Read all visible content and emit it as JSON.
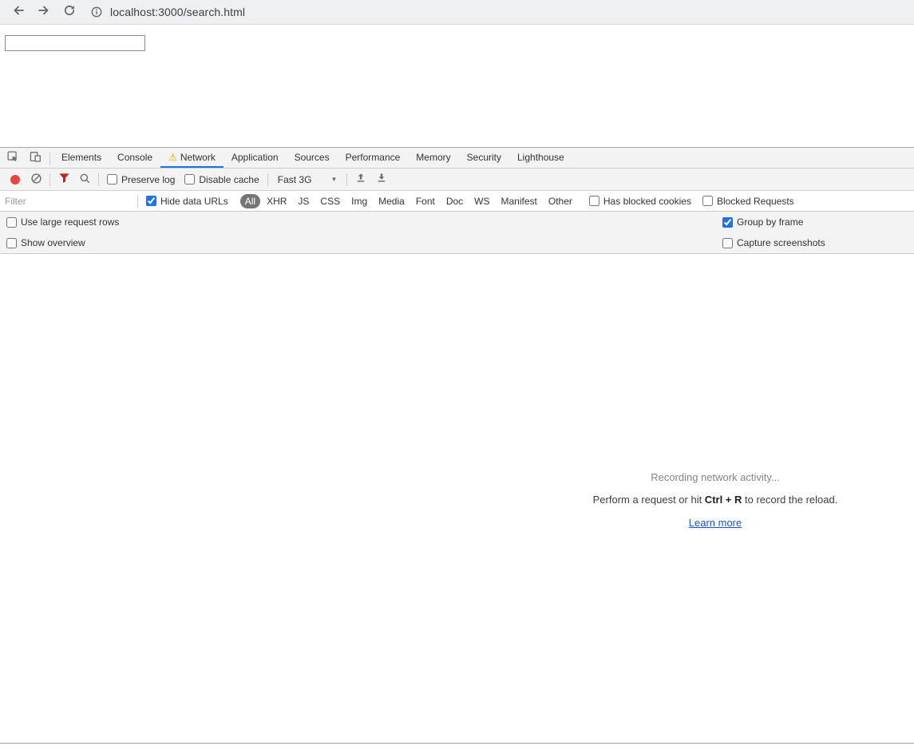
{
  "browser": {
    "url": "localhost:3000/search.html"
  },
  "page": {
    "search_value": ""
  },
  "devtools": {
    "tabs": [
      "Elements",
      "Console",
      "Network",
      "Application",
      "Sources",
      "Performance",
      "Memory",
      "Security",
      "Lighthouse"
    ],
    "active_tab": "Network",
    "toolbar": {
      "preserve_log_label": "Preserve log",
      "preserve_log_checked": false,
      "disable_cache_label": "Disable cache",
      "disable_cache_checked": false,
      "throttling_value": "Fast 3G"
    },
    "filter_bar": {
      "filter_placeholder": "Filter",
      "hide_data_urls_label": "Hide data URLs",
      "hide_data_urls_checked": true,
      "type_filters": [
        "All",
        "XHR",
        "JS",
        "CSS",
        "Img",
        "Media",
        "Font",
        "Doc",
        "WS",
        "Manifest",
        "Other"
      ],
      "selected_type": "All",
      "has_blocked_cookies_label": "Has blocked cookies",
      "has_blocked_cookies_checked": false,
      "blocked_requests_label": "Blocked Requests",
      "blocked_requests_checked": false
    },
    "options": {
      "use_large_request_rows_label": "Use large request rows",
      "use_large_request_rows_checked": false,
      "group_by_frame_label": "Group by frame",
      "group_by_frame_checked": true,
      "show_overview_label": "Show overview",
      "show_overview_checked": false,
      "capture_screenshots_label": "Capture screenshots",
      "capture_screenshots_checked": false
    },
    "empty_state": {
      "title": "Recording network activity...",
      "hint_prefix": "Perform a request or hit ",
      "hint_shortcut": "Ctrl + R",
      "hint_suffix": " to record the reload.",
      "link_label": "Learn more"
    },
    "colors": {
      "accent": "#1a73e8",
      "record_red": "#e8453c",
      "warning_orange": "#e8a600"
    }
  }
}
